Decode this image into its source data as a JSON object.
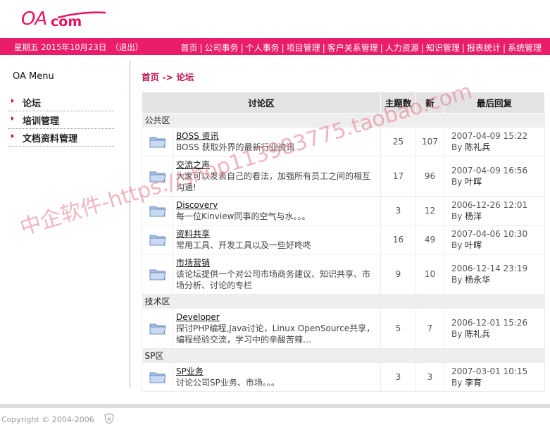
{
  "logo": {
    "oa": "OA",
    "com": "com"
  },
  "header": {
    "date": "星期五 2015年10月23日",
    "logout": "（退出）",
    "menu": [
      "首页",
      "公司事务",
      "个人事务",
      "项目管理",
      "客户关系管理",
      "人力资源",
      "知识管理",
      "报表统计",
      "系统管理"
    ]
  },
  "sidebar": {
    "title": "OA Menu",
    "items": [
      "论坛",
      "培训管理",
      "文档资料管理"
    ]
  },
  "breadcrumb": "首页 -> 论坛",
  "table": {
    "headers": {
      "board": "讨论区",
      "topics": "主题数",
      "news": "新",
      "last": "最后回复"
    },
    "sections": [
      {
        "name": "公共区",
        "rows": [
          {
            "name": "BOSS 资讯",
            "desc": "BOSS 获取外界的最新行业资讯",
            "topics": "25",
            "news": "107",
            "date": "2007-04-09 15:22",
            "by": "By",
            "user": "陈礼兵"
          },
          {
            "name": "交流之声",
            "desc": "大家可以发表自己的看法，加强所有员工之间的相互沟通!",
            "topics": "17",
            "news": "96",
            "date": "2007-04-09 16:56",
            "by": "By",
            "user": "叶晖"
          },
          {
            "name": "Discovery",
            "desc": "每一位Kinview同事的空气与水。。。",
            "topics": "3",
            "news": "12",
            "date": "2006-12-26 12:01",
            "by": "By",
            "user": "杨洋"
          },
          {
            "name": "资料共享",
            "desc": "常用工具、开发工具以及一些好咚咚",
            "topics": "16",
            "news": "49",
            "date": "2007-04-06 10:30",
            "by": "By",
            "user": "叶晖"
          },
          {
            "name": "市场营销",
            "desc": "该论坛提供一个对公司市场商务建议、知识共享、市场分析、讨论的专栏",
            "topics": "9",
            "news": "10",
            "date": "2006-12-14 23:19",
            "by": "By",
            "user": "杨永华"
          }
        ]
      },
      {
        "name": "技术区",
        "rows": [
          {
            "name": "Developer",
            "desc": "探讨PHP编程,Java讨论，Linux OpenSource共享，编程经验交流，学习中的辛酸苦辣…",
            "topics": "5",
            "news": "7",
            "date": "2006-12-01 15:26",
            "by": "By",
            "user": "陈礼兵"
          }
        ]
      },
      {
        "name": "SP区",
        "rows": [
          {
            "name": "SP业务",
            "desc": "讨论公司SP业务、市场。。。",
            "topics": "3",
            "news": "3",
            "date": "2007-03-01 10:15",
            "by": "By",
            "user": "李育"
          }
        ]
      }
    ]
  },
  "footer": {
    "copyright": "Copyright © 2004-2006"
  },
  "watermark": "中企软件-https://shop113983775.taobao.com",
  "colors": {
    "brand": "#ea1d6a",
    "crumb": "#c2124e",
    "header_bg": "#e3e3e3"
  }
}
